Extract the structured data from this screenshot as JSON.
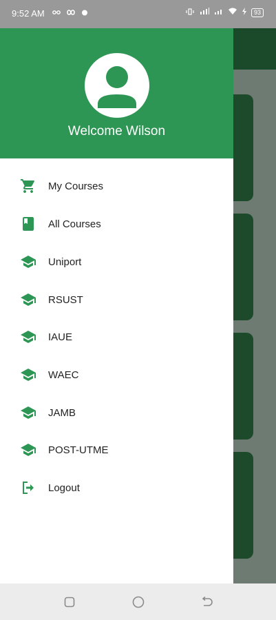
{
  "status_bar": {
    "time": "9:52 AM",
    "battery": "93"
  },
  "drawer": {
    "welcome_text": "Welcome Wilson",
    "items": [
      {
        "label": "My Courses",
        "icon": "cart-icon"
      },
      {
        "label": "All Courses",
        "icon": "book-icon"
      },
      {
        "label": "Uniport",
        "icon": "graduation-cap-icon"
      },
      {
        "label": "RSUST",
        "icon": "graduation-cap-icon"
      },
      {
        "label": "IAUE",
        "icon": "graduation-cap-icon"
      },
      {
        "label": "WAEC",
        "icon": "graduation-cap-icon"
      },
      {
        "label": "JAMB",
        "icon": "graduation-cap-icon"
      },
      {
        "label": "POST-UTME",
        "icon": "graduation-cap-icon"
      },
      {
        "label": "Logout",
        "icon": "logout-icon"
      }
    ]
  },
  "colors": {
    "primary": "#2e9654",
    "dark": "#1b4a2b"
  }
}
